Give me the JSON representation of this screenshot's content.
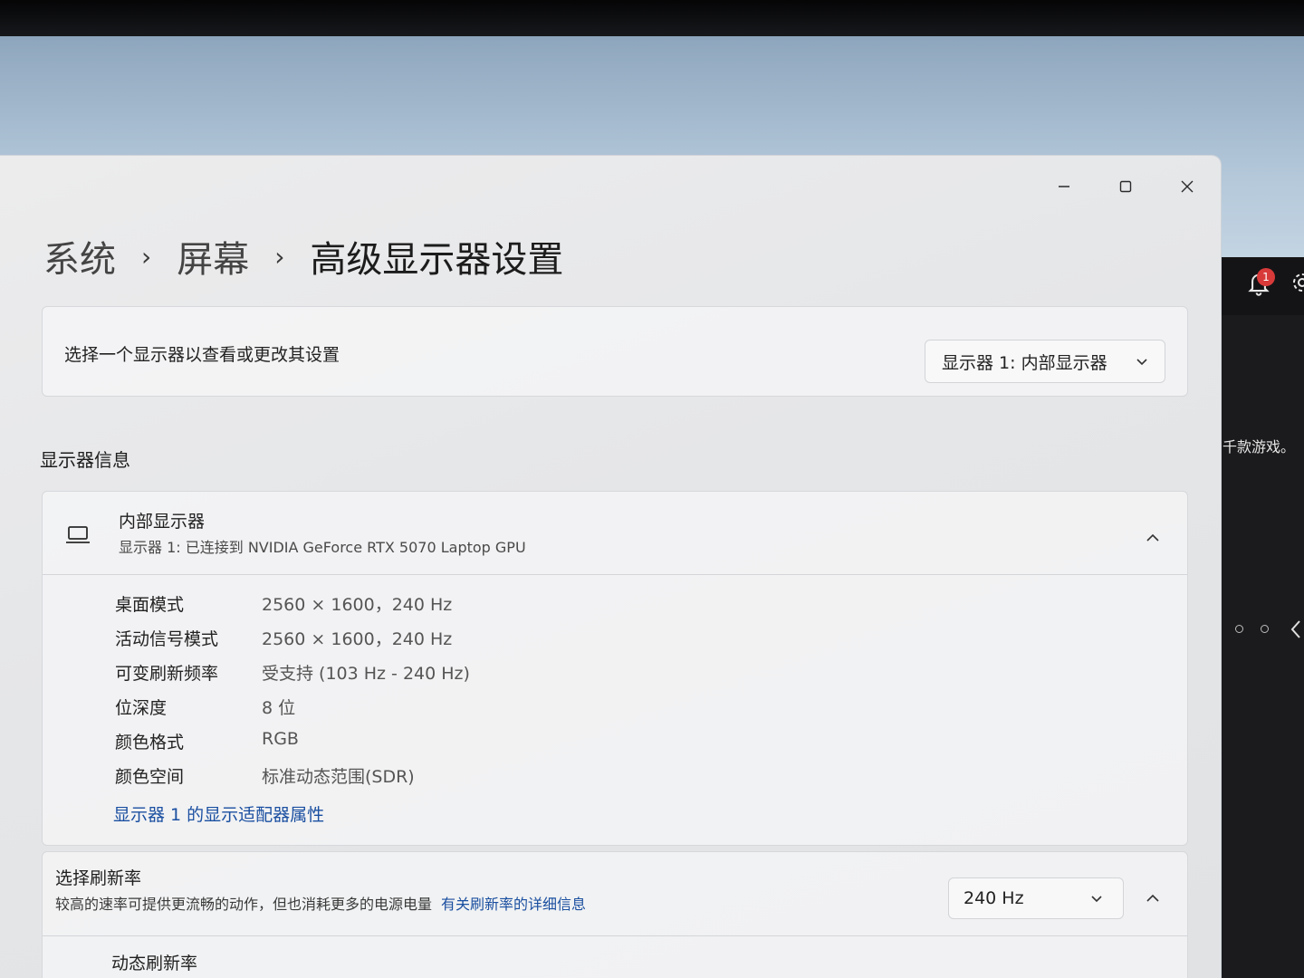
{
  "breadcrumb": {
    "system": "系统",
    "screen": "屏幕",
    "current": "高级显示器设置",
    "separator": "›"
  },
  "select_display": {
    "label": "选择一个显示器以查看或更改其设置",
    "selected": "显示器 1: 内部显示器"
  },
  "section_title": "显示器信息",
  "display_info": {
    "title": "内部显示器",
    "subtitle": "显示器 1: 已连接到 NVIDIA GeForce RTX 5070 Laptop GPU",
    "properties": [
      {
        "label": "桌面模式",
        "value": "2560 × 1600，240 Hz"
      },
      {
        "label": "活动信号模式",
        "value": "2560 × 1600，240 Hz"
      },
      {
        "label": "可变刷新频率",
        "value": "受支持 (103 Hz - 240 Hz)"
      },
      {
        "label": "位深度",
        "value": "8 位"
      },
      {
        "label": "颜色格式",
        "value": "RGB"
      },
      {
        "label": "颜色空间",
        "value": "标准动态范围(SDR)"
      }
    ],
    "adapter_link": "显示器 1 的显示适配器属性"
  },
  "refresh_rate": {
    "title": "选择刷新率",
    "description": "较高的速率可提供更流畅的动作，但也消耗更多的电源电量",
    "link": "有关刷新率的详细信息",
    "selected": "240 Hz",
    "dynamic_title": "动态刷新率"
  },
  "background_app": {
    "badge_count": "1",
    "text": "千款游戏。"
  },
  "icons": {
    "minimize": "minimize-icon",
    "maximize": "maximize-icon",
    "close": "close-icon",
    "laptop": "laptop-icon",
    "chevron_down": "chevron-down-icon",
    "chevron_up": "chevron-up-icon",
    "bell": "bell-icon",
    "gear": "gear-icon"
  }
}
